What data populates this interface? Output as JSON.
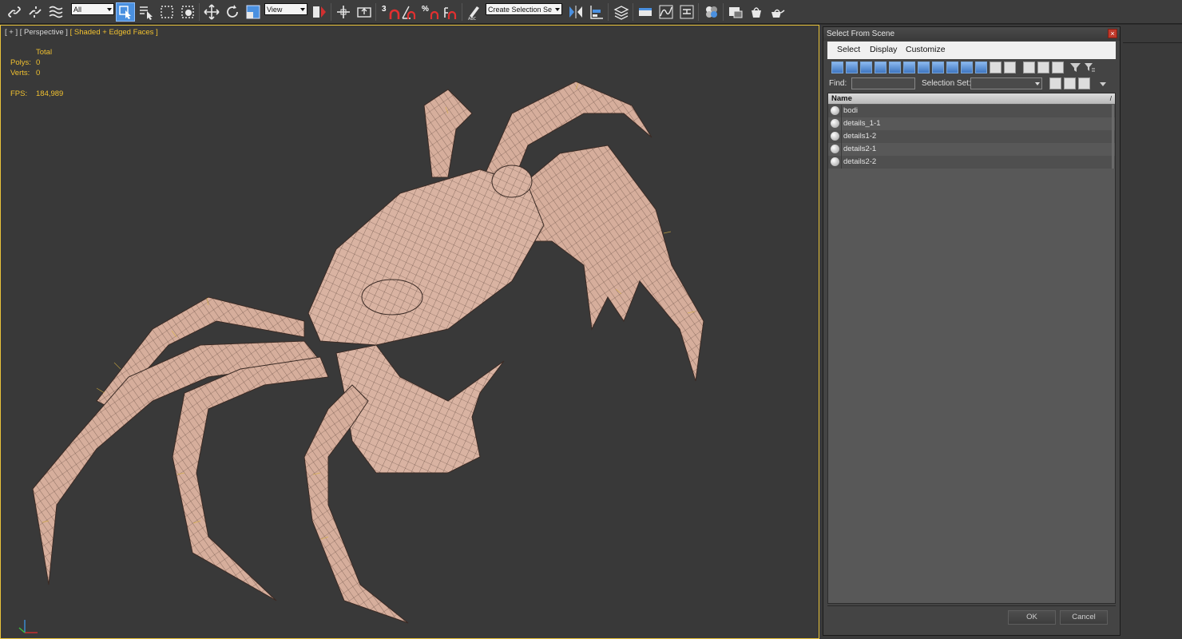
{
  "toolbar": {
    "filter_dropdown": "All",
    "ref_coord_dropdown": "View",
    "snap_label": "3",
    "percent_label": "%",
    "named_selection_dropdown": "Create Selection Se"
  },
  "viewport": {
    "label_plus": "[ + ]",
    "label_view": "[ Perspective ]",
    "label_shading": "[ Shaded + Edged Faces ]",
    "stats": {
      "header": "Total",
      "polys_label": "Polys:",
      "polys_value": "0",
      "verts_label": "Verts:",
      "verts_value": "0",
      "fps_label": "FPS:",
      "fps_value": "184,989"
    }
  },
  "dialog": {
    "title": "Select From Scene",
    "close_glyph": "×",
    "menu": [
      "Select",
      "Display",
      "Customize"
    ],
    "find_label": "Find:",
    "find_value": "",
    "selection_set_label": "Selection Set:",
    "selection_set_value": "",
    "list_header": "Name",
    "sort_glyph": "/",
    "items": [
      "bodi",
      "details_1-1",
      "details1-2",
      "details2-1",
      "details2-2"
    ],
    "ok_label": "OK",
    "cancel_label": "Cancel"
  },
  "colors": {
    "viewport_bg": "#393939",
    "viewport_border": "#e8c23a",
    "stats_text": "#f0c030",
    "mesh": "#d9b3a2",
    "active_tool": "#4a90e0"
  },
  "icons": [
    "link-icon",
    "unlink-icon",
    "bind-spacewarp-icon",
    "select-object-icon",
    "select-by-name-icon",
    "rect-selection-icon",
    "window-crossing-icon",
    "move-icon",
    "rotate-icon",
    "scale-icon",
    "pivot-icon",
    "manipulate-icon",
    "keyboard-shortcut-icon",
    "snap-toggle-icon",
    "angle-snap-icon",
    "percent-snap-icon",
    "spinner-snap-icon",
    "edit-named-selection-icon",
    "mirror-icon",
    "align-icon",
    "layer-manager-icon",
    "graphite-ribbon-icon",
    "curve-editor-icon",
    "schematic-view-icon",
    "material-editor-icon",
    "render-setup-icon",
    "render-frame-icon",
    "render-icon"
  ]
}
